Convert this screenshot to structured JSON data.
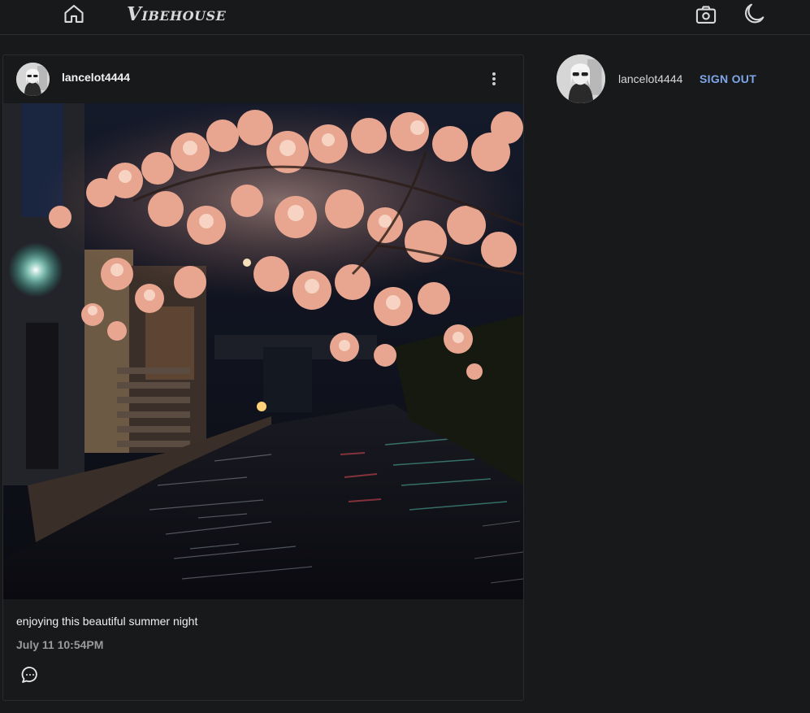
{
  "header": {
    "brand": "Vibehouse",
    "home_icon": "home-icon",
    "camera_icon": "camera-icon",
    "theme_icon": "moon-icon"
  },
  "post": {
    "username": "lancelot4444",
    "caption": "enjoying this beautiful summer night",
    "timestamp": "July 11 10:54PM",
    "menu_icon": "more-vertical-icon",
    "comment_icon": "comment-icon"
  },
  "sidebar": {
    "username": "lancelot4444",
    "sign_out_label": "SIGN OUT"
  },
  "colors": {
    "background": "#18191b",
    "accent": "#7ea6e8",
    "muted_text": "#9a9a9a"
  }
}
